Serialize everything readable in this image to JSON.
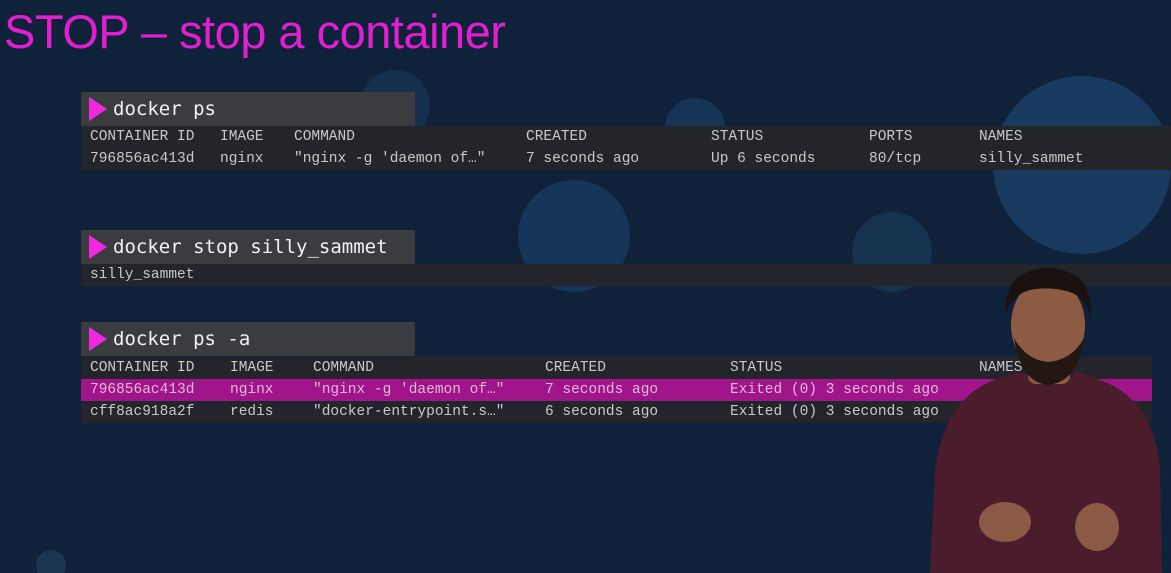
{
  "title": "STOP – stop a container",
  "commands": [
    {
      "text": "docker ps",
      "headers": [
        "CONTAINER ID",
        "IMAGE",
        "COMMAND",
        "CREATED",
        "STATUS",
        "PORTS",
        "NAMES"
      ],
      "rows": [
        [
          "796856ac413d",
          "nginx",
          "\"nginx -g 'daemon of…\"",
          "7 seconds ago",
          "Up 6 seconds",
          "80/tcp",
          "silly_sammet"
        ]
      ]
    },
    {
      "text": "docker stop silly_sammet",
      "output": "silly_sammet"
    },
    {
      "text": "docker ps -a",
      "headers": [
        "CONTAINER ID",
        "IMAGE",
        "COMMAND",
        "CREATED",
        "STATUS",
        "NAMES"
      ],
      "rows": [
        [
          "796856ac413d",
          "nginx",
          "\"nginx -g 'daemon of…\"",
          "7 seconds ago",
          "Exited (0) 3 seconds ago"
        ],
        [
          "cff8ac918a2f",
          "redis",
          "\"docker-entrypoint.s…\"",
          "6 seconds ago",
          "Exited (0) 3 seconds ago"
        ]
      ],
      "highlighted_row": 0
    }
  ],
  "colors": {
    "background": "#10223a",
    "title": "#e21fd0",
    "prompt": "#f028e0",
    "highlight": "#a0168a"
  },
  "icons": {
    "prompt": "play-triangle-icon"
  }
}
